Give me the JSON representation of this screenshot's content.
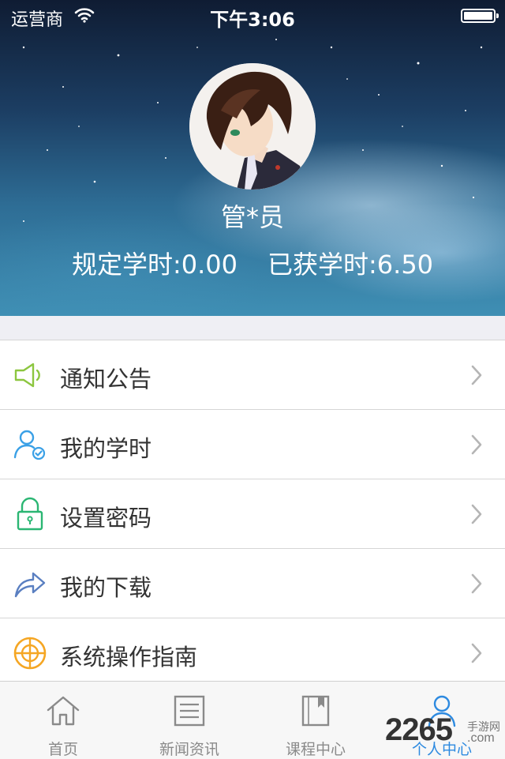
{
  "status_bar": {
    "carrier": "运营商",
    "time": "下午3:06"
  },
  "profile": {
    "username": "管*员",
    "required_hours": "规定学时:0.00",
    "earned_hours": "已获学时:6.50"
  },
  "menu": {
    "items": [
      {
        "label": "通知公告",
        "icon": "megaphone-icon",
        "color": "#8cc63f"
      },
      {
        "label": "我的学时",
        "icon": "user-check-icon",
        "color": "#3aa0e6"
      },
      {
        "label": "设置密码",
        "icon": "lock-icon",
        "color": "#2bb673"
      },
      {
        "label": "我的下载",
        "icon": "share-arrow-icon",
        "color": "#5a7fc1"
      },
      {
        "label": "系统操作指南",
        "icon": "target-icon",
        "color": "#f5a623"
      }
    ]
  },
  "tabbar": {
    "tabs": [
      {
        "label": "首页",
        "icon": "home-icon"
      },
      {
        "label": "新闻资讯",
        "icon": "news-icon"
      },
      {
        "label": "课程中心",
        "icon": "book-icon"
      },
      {
        "label": "个人中心",
        "icon": "person-icon",
        "active": true
      }
    ]
  },
  "watermark": {
    "number": "2265",
    "site": "手游网",
    "domain": ".com"
  },
  "colors": {
    "active": "#2d8ae0",
    "inactive": "#8a8a8a"
  }
}
